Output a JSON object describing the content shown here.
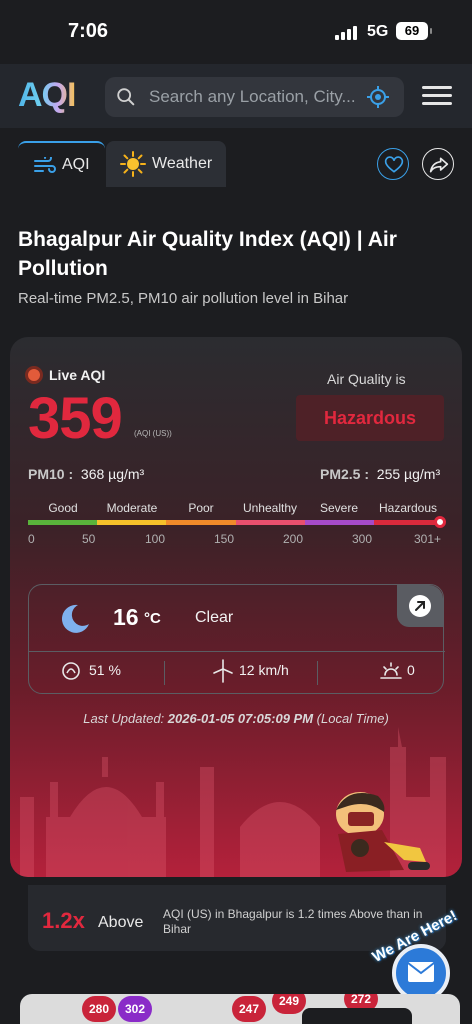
{
  "status_bar": {
    "time": "7:06",
    "network": "5G",
    "battery": "69"
  },
  "header": {
    "logo": "AQI",
    "search_placeholder": "Search any Location, City..."
  },
  "tabs": [
    {
      "label": "AQI"
    },
    {
      "label": "Weather"
    }
  ],
  "page": {
    "title": "Bhagalpur Air Quality Index (AQI) | Air Pollution",
    "subtitle": "Real-time PM2.5, PM10 air pollution level in Bihar"
  },
  "aqi_card": {
    "live_label": "Live AQI",
    "value": "359",
    "unit": "(AQI (US))",
    "quality_label": "Air Quality is",
    "quality_value": "Hazardous",
    "pm10_label": "PM10 :",
    "pm10_value": "368 µg/m³",
    "pm25_label": "PM2.5 :",
    "pm25_value": "255 µg/m³",
    "categories": [
      "Good",
      "Moderate",
      "Poor",
      "Unhealthy",
      "Severe",
      "Hazardous"
    ],
    "category_colors": [
      "#59b33b",
      "#f5c02a",
      "#f08a2a",
      "#e8506e",
      "#a64bc8",
      "#d92a3c"
    ],
    "ticks": [
      "0",
      "50",
      "100",
      "150",
      "200",
      "300",
      "301+"
    ],
    "weather": {
      "temperature": "16",
      "temp_unit": "°C",
      "condition": "Clear",
      "humidity": "51 %",
      "wind": "12 km/h",
      "uv": "0"
    },
    "updated_prefix": "Last Updated: ",
    "updated_value": "2026-01-05 07:05:09 PM",
    "updated_suffix": " (Local Time)"
  },
  "comparison": {
    "value": "1.2x",
    "direction": "Above",
    "description": "AQI (US) in Bhagalpur is 1.2 times Above than in Bihar"
  },
  "floating": {
    "badge": "We Are Here!"
  },
  "map_pins": [
    "280",
    "302",
    "247",
    "249",
    "272"
  ]
}
